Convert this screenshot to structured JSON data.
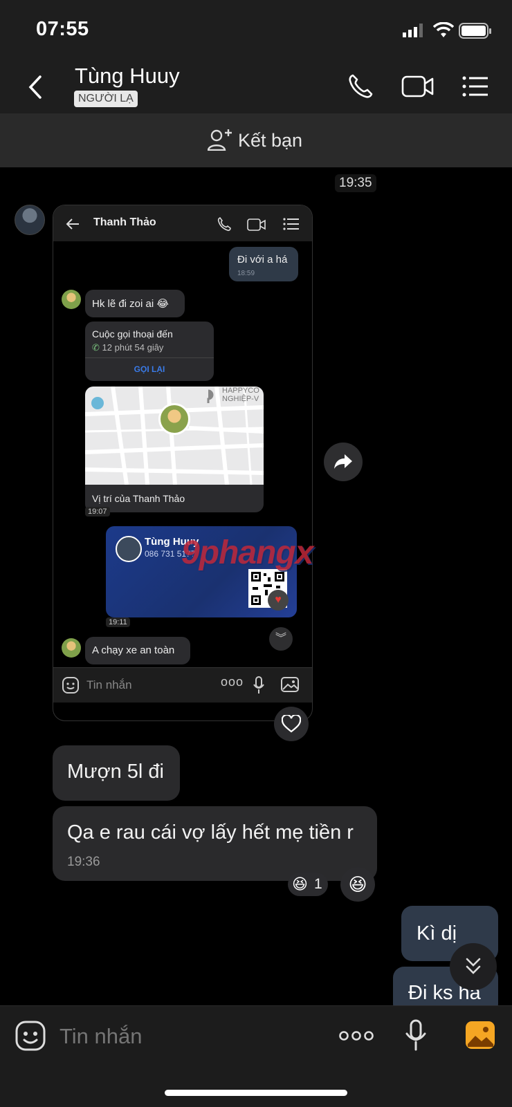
{
  "status_bar": {
    "time": "07:55"
  },
  "header": {
    "contact_name": "Tùng Huuy",
    "badge": "NGƯỜI LẠ"
  },
  "friend_bar": {
    "label": "Kết bạn"
  },
  "chat": {
    "date_time": "19:35",
    "screenshot": {
      "contact_name": "Thanh Thảo",
      "msg_sent": "Đi với a há",
      "msg_sent_time": "18:59",
      "msg_received": "Hk lẽ đi zoi ai 😂",
      "call_title": "Cuộc gọi thoại đến",
      "call_duration": "12 phút 54 giây",
      "call_back": "GỌI LẠI",
      "map_caption": "Vị trí của Thanh Thảo",
      "map_label_line1": "HAPPYCO",
      "map_label_line2": "NGHIỆP-V",
      "map_time": "19:07",
      "card_name": "Tùng Huuy",
      "card_phone": "086 731 5177",
      "card_time": "19:11",
      "last_msg": "A chạy xe an toàn",
      "input_placeholder": "Tin nhắn"
    },
    "watermark": "9phangx",
    "msg1": "Mượn 5l đi",
    "msg2": "Qa e rau cái vợ lấy hết mẹ tiền r",
    "msg2_time": "19:36",
    "reaction_count": "1",
    "mine1": "Kì dị",
    "mine2": "Đi ks ha"
  },
  "input": {
    "placeholder": "Tin nhắn"
  },
  "colors": {
    "accent_blue": "#2f6fe0",
    "card_blue": "#1c3a8a",
    "gallery_orange": "#f5a623"
  }
}
